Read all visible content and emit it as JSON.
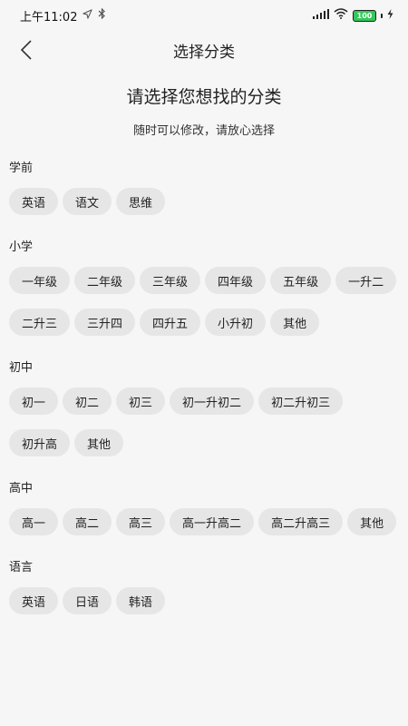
{
  "status_bar": {
    "time": "上午11:02",
    "battery": "100"
  },
  "nav": {
    "title": "选择分类"
  },
  "heading": "请选择您想找的分类",
  "subheading": "随时可以修改，请放心选择",
  "sections": [
    {
      "title": "学前",
      "chips": [
        "英语",
        "语文",
        "思维"
      ]
    },
    {
      "title": "小学",
      "chips": [
        "一年级",
        "二年级",
        "三年级",
        "四年级",
        "五年级",
        "一升二",
        "二升三",
        "三升四",
        "四升五",
        "小升初",
        "其他"
      ]
    },
    {
      "title": "初中",
      "chips": [
        "初一",
        "初二",
        "初三",
        "初一升初二",
        "初二升初三",
        "初升高",
        "其他"
      ]
    },
    {
      "title": "高中",
      "chips": [
        "高一",
        "高二",
        "高三",
        "高一升高二",
        "高二升高三",
        "其他"
      ]
    },
    {
      "title": "语言",
      "chips": [
        "英语",
        "日语",
        "韩语"
      ]
    }
  ]
}
